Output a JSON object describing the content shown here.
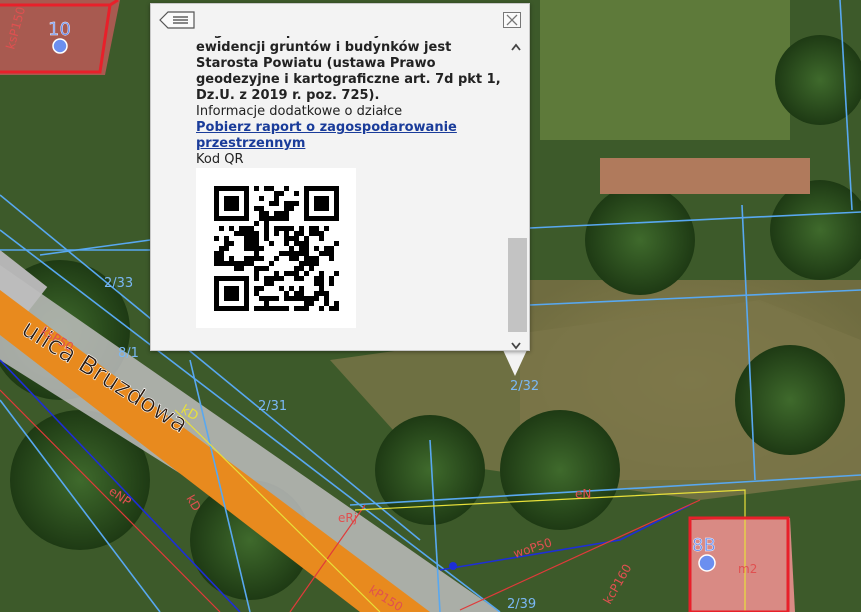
{
  "map": {
    "street_name": "ulica Bruzdowa",
    "parcel_labels": [
      "2/33",
      "8/1",
      "2/31",
      "2/32",
      "2/39",
      "10",
      "8B"
    ],
    "utility_labels": [
      "ksP150",
      "ksP50",
      "kP150",
      "kD",
      "eN",
      "eNP",
      "eN",
      "eRj",
      "woP50",
      "kcP160",
      "m2",
      "kD"
    ],
    "colors": {
      "parcel_line": "#58a8f0",
      "building_outline": "#e8202a",
      "road": "#e88a1e",
      "water_line": "#1d2ed8",
      "power_line": "#e03a3a",
      "yellow_line": "#e8e03a",
      "point_marker": "#6b8ff0"
    }
  },
  "popup": {
    "back_icon": "list-back-icon",
    "close_icon": "close-icon",
    "text_bold": "Organem odpowiedzialnym za dane ewidencji gruntów i budynków jest Starosta Powiatu (ustawa Prawo geodezyjne i kartograficzne art. 7d pkt 1, Dz.U. z 2019 r. poz. 725).",
    "additional_info": "Informacje dodatkowe o działce",
    "report_link": "Pobierz raport o zagospodarowanie przestrzennym",
    "qr_label": "Kod QR"
  }
}
